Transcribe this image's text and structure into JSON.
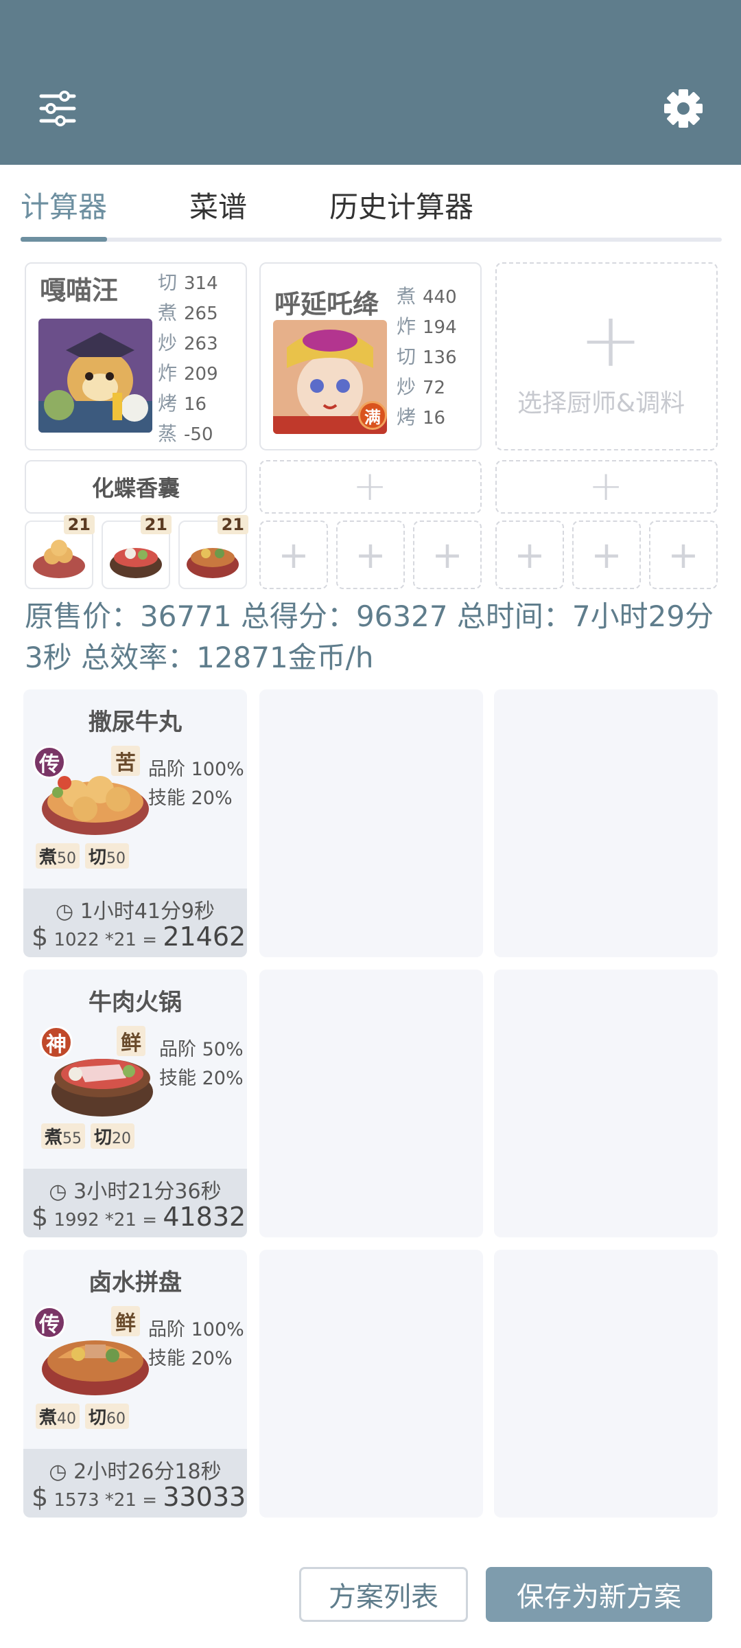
{
  "tabs": [
    "计算器",
    "菜谱",
    "历史计算器"
  ],
  "chefs": [
    {
      "name": "嘎喵汪",
      "stats": [
        {
          "k": "切",
          "v": "314"
        },
        {
          "k": "煮",
          "v": "265"
        },
        {
          "k": "炒",
          "v": "263"
        },
        {
          "k": "炸",
          "v": "209"
        },
        {
          "k": "烤",
          "v": "16"
        },
        {
          "k": "蒸",
          "v": "-50"
        }
      ]
    },
    {
      "name": "呼延吒绛",
      "badge": "满",
      "stats": [
        {
          "k": "煮",
          "v": "440"
        },
        {
          "k": "炸",
          "v": "194"
        },
        {
          "k": "切",
          "v": "136"
        },
        {
          "k": "炒",
          "v": "72"
        },
        {
          "k": "烤",
          "v": "16"
        }
      ]
    }
  ],
  "add_chef_label": "选择厨师&调料",
  "equip_label": "化蝶香囊",
  "mini_counts": [
    "21",
    "21",
    "21"
  ],
  "summary": {
    "text": "原售价：36771 总得分：96327 总时间：7小时29分3秒 总效率：12871金币/h"
  },
  "recipes": [
    {
      "title": "撒尿牛丸",
      "rarity": "传",
      "rarity_color": "#7a3566",
      "flavor": "苦",
      "quality": "品阶 100%",
      "skill": "技能 20%",
      "reqs": [
        {
          "k": "煮",
          "v": "50"
        },
        {
          "k": "切",
          "v": "50"
        }
      ],
      "time": "1小时41分9秒",
      "price": "1022 *21",
      "eq": "=",
      "total": "21462"
    },
    {
      "title": "牛肉火锅",
      "rarity": "神",
      "rarity_color": "#c0492a",
      "flavor": "鲜",
      "quality": "品阶 50%",
      "skill": "技能 20%",
      "reqs": [
        {
          "k": "煮",
          "v": "55"
        },
        {
          "k": "切",
          "v": "20"
        }
      ],
      "time": "3小时21分36秒",
      "price": "1992 *21",
      "eq": "=",
      "total": "41832"
    },
    {
      "title": "卤水拼盘",
      "rarity": "传",
      "rarity_color": "#7a3566",
      "flavor": "鲜",
      "quality": "品阶 100%",
      "skill": "技能 20%",
      "reqs": [
        {
          "k": "煮",
          "v": "40"
        },
        {
          "k": "切",
          "v": "60"
        }
      ],
      "time": "2小时26分18秒",
      "price": "1573 *21",
      "eq": "=",
      "total": "33033"
    }
  ],
  "buttons": {
    "list": "方案列表",
    "save": "保存为新方案"
  },
  "icons": {
    "left": "sliders-icon",
    "right": "gear-icon",
    "clock": "clock-icon"
  },
  "colors": {
    "header": "#5f7d8c",
    "accent": "#6d8fa0",
    "save_button": "#7e9cad"
  }
}
